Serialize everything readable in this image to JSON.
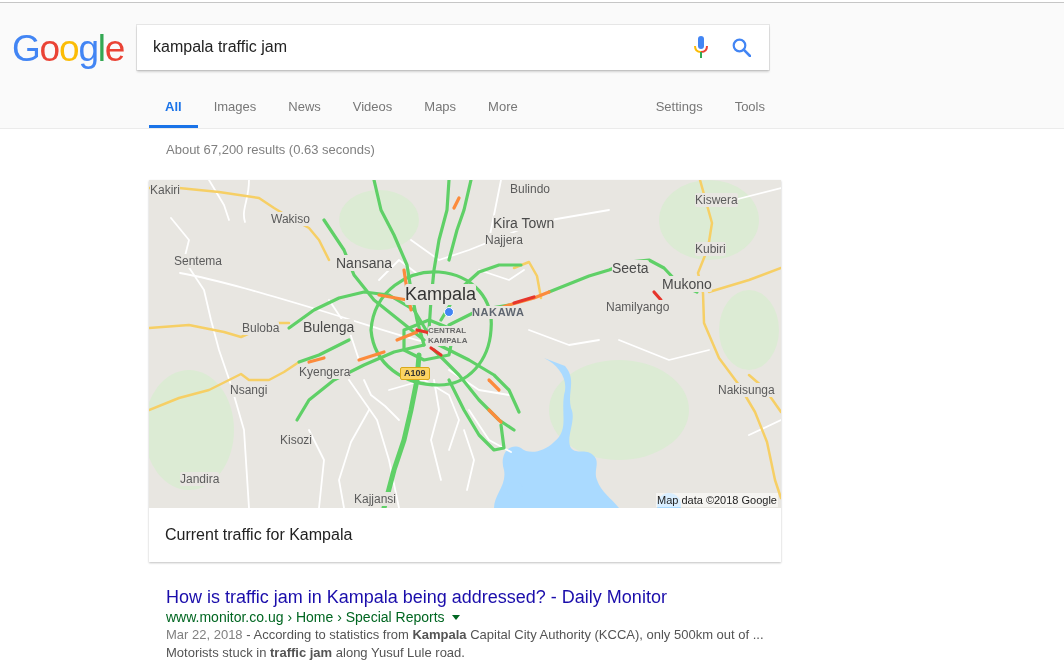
{
  "header": {
    "logo": "Google",
    "search": {
      "value": "kampala traffic jam"
    }
  },
  "tabs": [
    {
      "label": "All",
      "selected": true
    },
    {
      "label": "Images",
      "selected": false
    },
    {
      "label": "News",
      "selected": false
    },
    {
      "label": "Videos",
      "selected": false
    },
    {
      "label": "Maps",
      "selected": false
    },
    {
      "label": "More",
      "selected": false
    }
  ],
  "tools": [
    "Settings",
    "Tools"
  ],
  "result_stats": "About 67,200 results (0.63 seconds)",
  "map_card": {
    "places": [
      {
        "name": "Bulindo",
        "kind": "village"
      },
      {
        "name": "Kakiri",
        "kind": "village"
      },
      {
        "name": "Kiswera",
        "kind": "village"
      },
      {
        "name": "Wakiso",
        "kind": "village"
      },
      {
        "name": "Kira Town",
        "kind": "town"
      },
      {
        "name": "Najjera",
        "kind": "village"
      },
      {
        "name": "Kubiri",
        "kind": "village"
      },
      {
        "name": "Sentema",
        "kind": "village"
      },
      {
        "name": "Nansana",
        "kind": "town"
      },
      {
        "name": "Seeta",
        "kind": "town"
      },
      {
        "name": "Mukono",
        "kind": "town"
      },
      {
        "name": "Kampala",
        "kind": "city"
      },
      {
        "name": "Namilyango",
        "kind": "village"
      },
      {
        "name": "NAKAWA",
        "kind": "district"
      },
      {
        "name": "Buloba",
        "kind": "village"
      },
      {
        "name": "Bulenga",
        "kind": "town"
      },
      {
        "name": "CENTRAL KAMPALA",
        "kind": "subdistrict"
      },
      {
        "name": "Kyengera",
        "kind": "village"
      },
      {
        "name": "Nsangi",
        "kind": "village"
      },
      {
        "name": "Nakisunga",
        "kind": "village"
      },
      {
        "name": "Kisozi",
        "kind": "village"
      },
      {
        "name": "Jandira",
        "kind": "village"
      },
      {
        "name": "Kajjansi",
        "kind": "village"
      }
    ],
    "road_label": "A109",
    "attribution": "Map data ©2018 Google",
    "caption": "Current traffic for Kampala"
  },
  "results": [
    {
      "title": "How is traffic jam in Kampala being addressed? - Daily Monitor",
      "url": "www.monitor.co.ug › Home › Special Reports",
      "date": "Mar 22, 2018",
      "snippet": "- According to statistics from **Kampala** Capital City Authority (KCCA), only 500km out of ... Motorists stuck in **traffic jam** along Yusuf Lule road."
    }
  ]
}
